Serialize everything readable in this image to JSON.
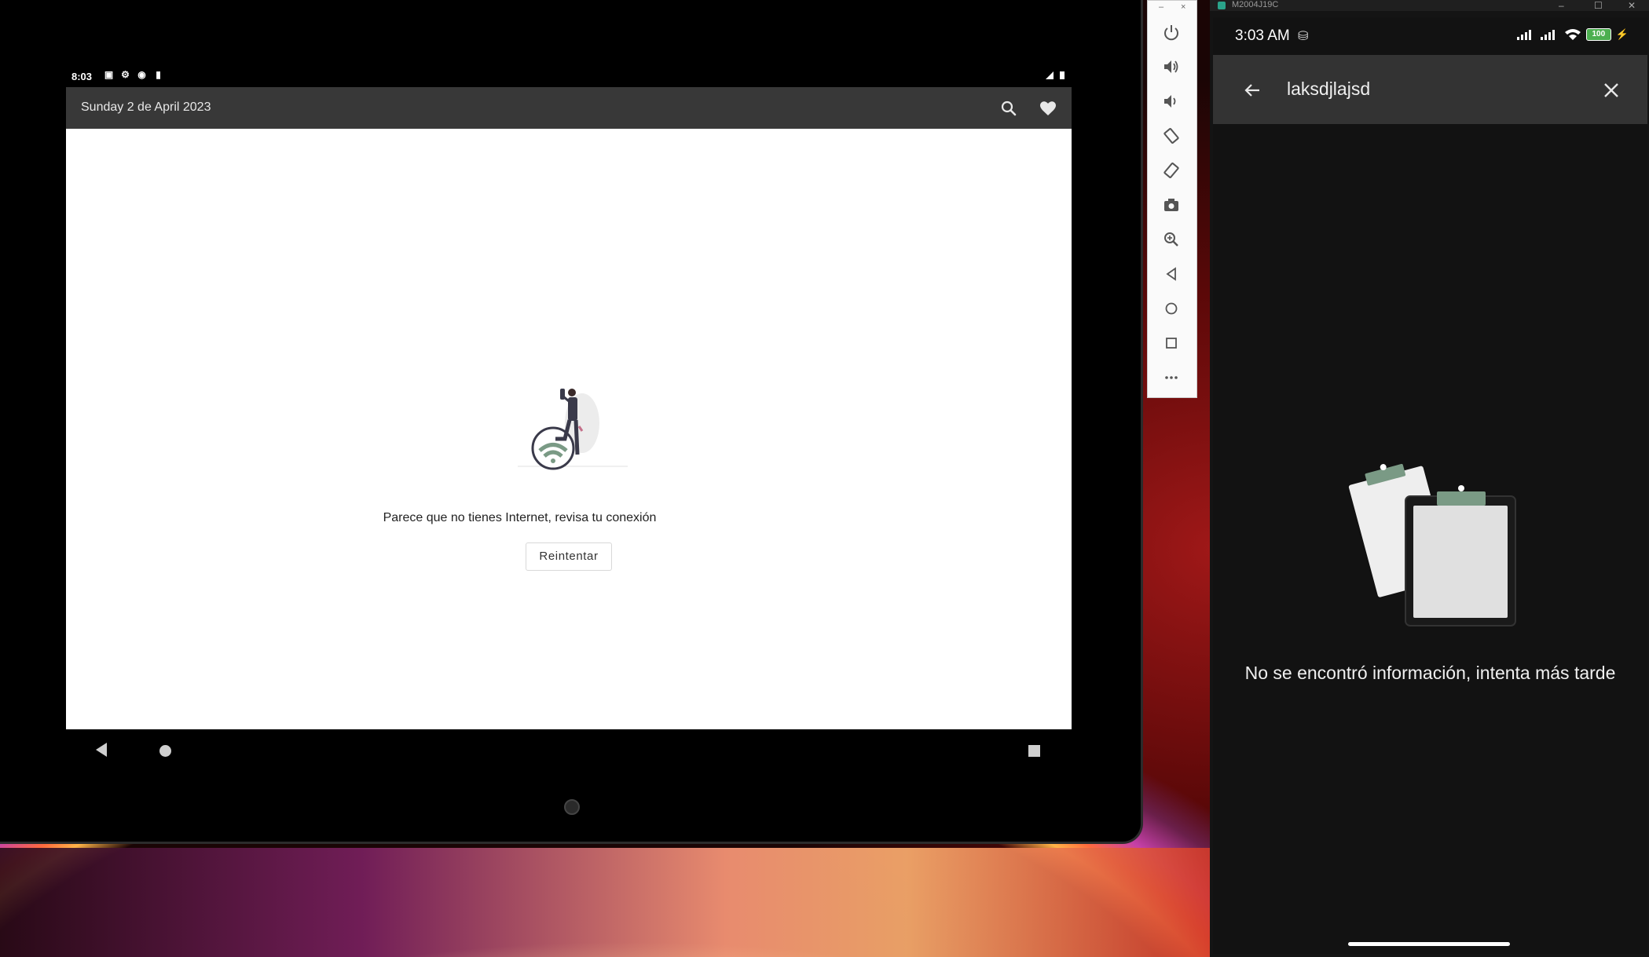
{
  "tablet": {
    "status_time": "8:03",
    "date_title": "Sunday 2 de April 2023",
    "no_internet_message": "Parece que no tienes Internet, revisa tu conexión",
    "retry_label": "Reintentar"
  },
  "emulator_toolbar": {
    "min_label": "–",
    "close_label": "×",
    "buttons": [
      "power-icon",
      "volume-up-icon",
      "volume-down-icon",
      "rotate-left-icon",
      "rotate-right-icon",
      "camera-icon",
      "zoom-icon",
      "back-icon",
      "home-icon",
      "overview-icon",
      "more-icon"
    ]
  },
  "phone_window": {
    "title": "M2004J19C",
    "status_time": "3:03 AM",
    "battery_level": "100",
    "search_query": "laksdjlajsd",
    "empty_message": "No se encontró información, intenta más tarde"
  },
  "colors": {
    "tablet_appbar": "#383838",
    "phone_searchbar": "#333333",
    "illustration_accent": "#7a9a85"
  }
}
